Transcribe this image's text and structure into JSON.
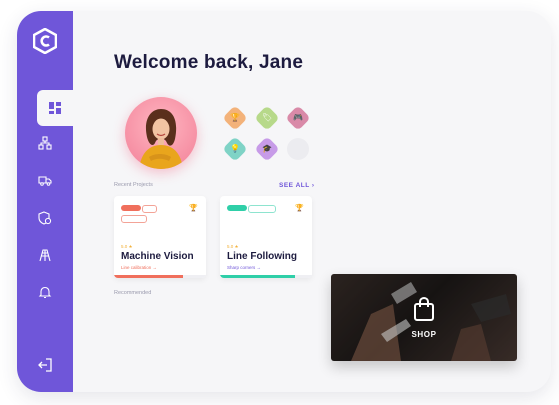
{
  "header": {
    "welcome": "Welcome back, Jane"
  },
  "sidebar": {
    "items": [
      {
        "icon": "dashboard-icon",
        "active": true
      },
      {
        "icon": "network-icon",
        "active": false
      },
      {
        "icon": "truck-icon",
        "active": false
      },
      {
        "icon": "shield-icon",
        "active": false
      },
      {
        "icon": "tower-icon",
        "active": false
      },
      {
        "icon": "bell-icon",
        "active": false
      }
    ],
    "logout_icon": "logout-icon"
  },
  "achievements": {
    "badges": [
      {
        "icon": "trophy-icon",
        "color": "#f3b27a"
      },
      {
        "icon": "tag-icon",
        "color": "#b7d98a"
      },
      {
        "icon": "gamepad-icon",
        "color": "#d98aa8"
      },
      {
        "icon": "bulb-icon",
        "color": "#7fd3c6"
      },
      {
        "icon": "graduation-icon",
        "color": "#c79be8"
      }
    ]
  },
  "recent": {
    "label": "Recent Projects",
    "see_all": "SEE ALL",
    "cards": [
      {
        "tags": [
          "",
          "",
          ""
        ],
        "rating": "5.0",
        "title": "Machine Vision",
        "subtitle": "Line calibration",
        "accent": "#f06f5c",
        "progress": 0.75
      },
      {
        "tags": [
          "",
          ""
        ],
        "rating": "5.0",
        "title": "Line Following",
        "subtitle": "Sharp corners",
        "accent": "#2fcfa8",
        "progress": 0.82
      }
    ]
  },
  "recommended": {
    "label": "Recommended"
  },
  "shop": {
    "label": "SHOP"
  },
  "colors": {
    "primary": "#6f56d9",
    "dark": "#1d1b3f"
  }
}
